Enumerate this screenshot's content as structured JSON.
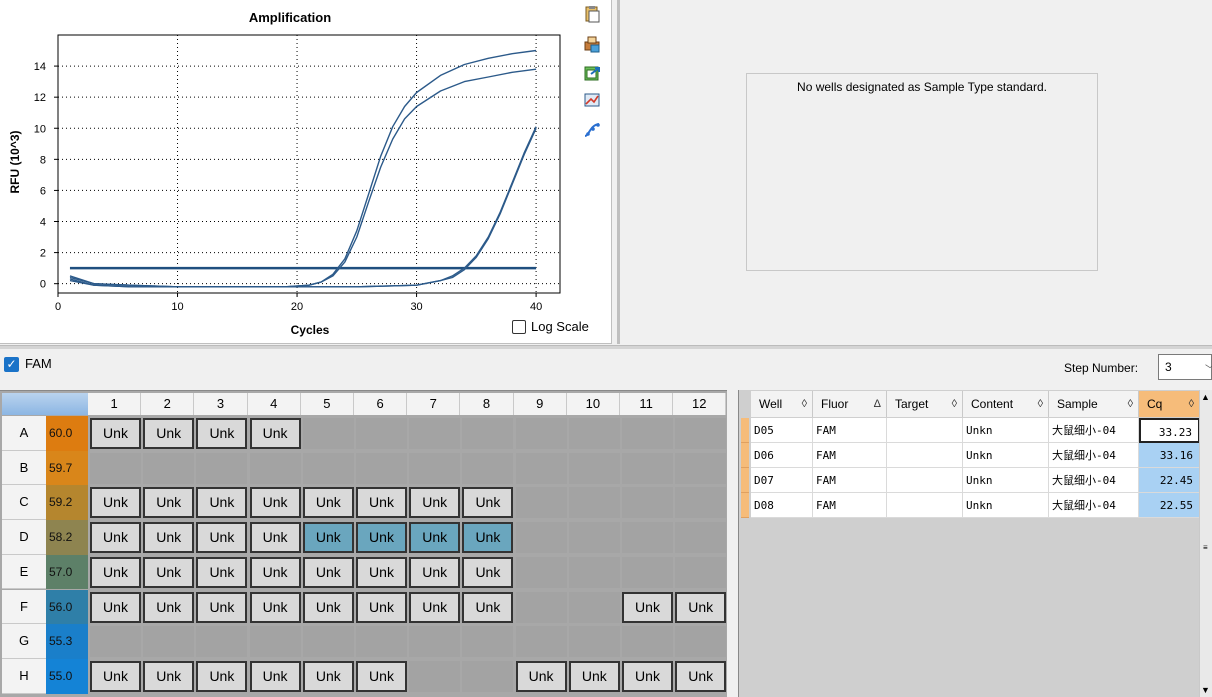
{
  "chart": {
    "title": "Amplification",
    "xlabel": "Cycles",
    "ylabel": "RFU (10^3)",
    "log_scale_label": "Log Scale"
  },
  "chart_data": {
    "type": "line",
    "title": "Amplification",
    "xlabel": "Cycles",
    "ylabel": "RFU (10^3)",
    "xlim": [
      0,
      42
    ],
    "ylim": [
      -0.6,
      16
    ],
    "x_ticks": [
      0,
      10,
      20,
      30,
      40
    ],
    "y_ticks": [
      0,
      2,
      4,
      6,
      8,
      10,
      12,
      14
    ],
    "grid": true,
    "threshold": 1.0,
    "series_color": "#2c5a8a",
    "series": [
      {
        "x": [
          1,
          3,
          6,
          10,
          15,
          19,
          21,
          22,
          23,
          24,
          25,
          26,
          27,
          28,
          29,
          30,
          32,
          34,
          36,
          38,
          40
        ],
        "values": [
          0.2,
          -0.1,
          -0.2,
          -0.2,
          -0.2,
          -0.2,
          -0.1,
          0.1,
          0.6,
          1.6,
          3.4,
          5.8,
          8.2,
          10.1,
          11.4,
          12.3,
          13.4,
          14.1,
          14.5,
          14.8,
          15.0
        ]
      },
      {
        "x": [
          1,
          3,
          6,
          10,
          15,
          19,
          21,
          22,
          23,
          24,
          25,
          26,
          27,
          28,
          29,
          30,
          32,
          34,
          36,
          38,
          40
        ],
        "values": [
          0.4,
          0.0,
          -0.1,
          -0.2,
          -0.2,
          -0.2,
          -0.1,
          0.1,
          0.5,
          1.4,
          3.0,
          5.3,
          7.5,
          9.3,
          10.6,
          11.4,
          12.4,
          13.0,
          13.3,
          13.6,
          13.8
        ]
      },
      {
        "x": [
          1,
          3,
          6,
          10,
          15,
          20,
          25,
          30,
          32,
          33,
          34,
          35,
          36,
          37,
          38,
          39,
          40
        ],
        "values": [
          0.3,
          -0.1,
          -0.2,
          -0.2,
          -0.2,
          -0.2,
          -0.2,
          -0.1,
          0.2,
          0.5,
          1.0,
          1.8,
          3.0,
          4.6,
          6.5,
          8.4,
          10.1
        ]
      },
      {
        "x": [
          1,
          3,
          6,
          10,
          15,
          20,
          25,
          30,
          32,
          33,
          34,
          35,
          36,
          37,
          38,
          39,
          40
        ],
        "values": [
          0.5,
          0.0,
          -0.1,
          -0.2,
          -0.2,
          -0.2,
          -0.2,
          -0.1,
          0.2,
          0.4,
          0.9,
          1.7,
          2.9,
          4.5,
          6.4,
          8.3,
          10.0
        ]
      }
    ]
  },
  "standard_curve": {
    "message": "No wells designated as Sample Type standard."
  },
  "fluor": {
    "label": "FAM",
    "checked": true
  },
  "step": {
    "label": "Step Number:",
    "value": "3"
  },
  "plate": {
    "columns": [
      "1",
      "2",
      "3",
      "4",
      "5",
      "6",
      "7",
      "8",
      "9",
      "10",
      "11",
      "12"
    ],
    "rows": [
      {
        "label": "A",
        "temp": "60.0",
        "color": "#dd7c10",
        "wells": [
          "Unk",
          "Unk",
          "Unk",
          "Unk",
          "",
          "",
          "",
          "",
          "",
          "",
          "",
          ""
        ]
      },
      {
        "label": "B",
        "temp": "59.7",
        "color": "#d9861a",
        "wells": [
          "",
          "",
          "",
          "",
          "",
          "",
          "",
          "",
          "",
          "",
          "",
          ""
        ]
      },
      {
        "label": "C",
        "temp": "59.2",
        "color": "#b5862e",
        "wells": [
          "Unk",
          "Unk",
          "Unk",
          "Unk",
          "Unk",
          "Unk",
          "Unk",
          "Unk",
          "",
          "",
          "",
          ""
        ]
      },
      {
        "label": "D",
        "temp": "58.2",
        "color": "#8e8450",
        "wells": [
          "Unk",
          "Unk",
          "Unk",
          "Unk",
          "Unk",
          "Unk",
          "Unk",
          "Unk",
          "",
          "",
          "",
          ""
        ]
      },
      {
        "label": "E",
        "temp": "57.0",
        "color": "#5d8068",
        "wells": [
          "Unk",
          "Unk",
          "Unk",
          "Unk",
          "Unk",
          "Unk",
          "Unk",
          "Unk",
          "",
          "",
          "",
          ""
        ]
      },
      {
        "label": "F",
        "temp": "56.0",
        "color": "#2f7fa8",
        "wells": [
          "Unk",
          "Unk",
          "Unk",
          "Unk",
          "Unk",
          "Unk",
          "Unk",
          "Unk",
          "",
          "",
          "Unk",
          "Unk"
        ]
      },
      {
        "label": "G",
        "temp": "55.3",
        "color": "#1a7fca",
        "wells": [
          "",
          "",
          "",
          "",
          "",
          "",
          "",
          "",
          "",
          "",
          "",
          ""
        ]
      },
      {
        "label": "H",
        "temp": "55.0",
        "color": "#1483d6",
        "wells": [
          "Unk",
          "Unk",
          "Unk",
          "Unk",
          "Unk",
          "Unk",
          "",
          "",
          "Unk",
          "Unk",
          "Unk",
          "Unk"
        ]
      }
    ],
    "selected": {
      "row": "D",
      "columns": [
        "5",
        "6",
        "7",
        "8"
      ]
    }
  },
  "results": {
    "headers": [
      {
        "label": "Well",
        "sort": "◊"
      },
      {
        "label": "Fluor",
        "sort": "Δ"
      },
      {
        "label": "Target",
        "sort": "◊"
      },
      {
        "label": "Content",
        "sort": "◊"
      },
      {
        "label": "Sample",
        "sort": "◊"
      },
      {
        "label": "Cq",
        "sort": "◊"
      }
    ],
    "rows": [
      {
        "well": "D05",
        "fluor": "FAM",
        "target": "",
        "content": "Unkn",
        "sample": "大鼠细小-04",
        "cq": "33.23"
      },
      {
        "well": "D06",
        "fluor": "FAM",
        "target": "",
        "content": "Unkn",
        "sample": "大鼠细小-04",
        "cq": "33.16"
      },
      {
        "well": "D07",
        "fluor": "FAM",
        "target": "",
        "content": "Unkn",
        "sample": "大鼠细小-04",
        "cq": "22.45"
      },
      {
        "well": "D08",
        "fluor": "FAM",
        "target": "",
        "content": "Unkn",
        "sample": "大鼠细小-04",
        "cq": "22.55"
      }
    ]
  }
}
